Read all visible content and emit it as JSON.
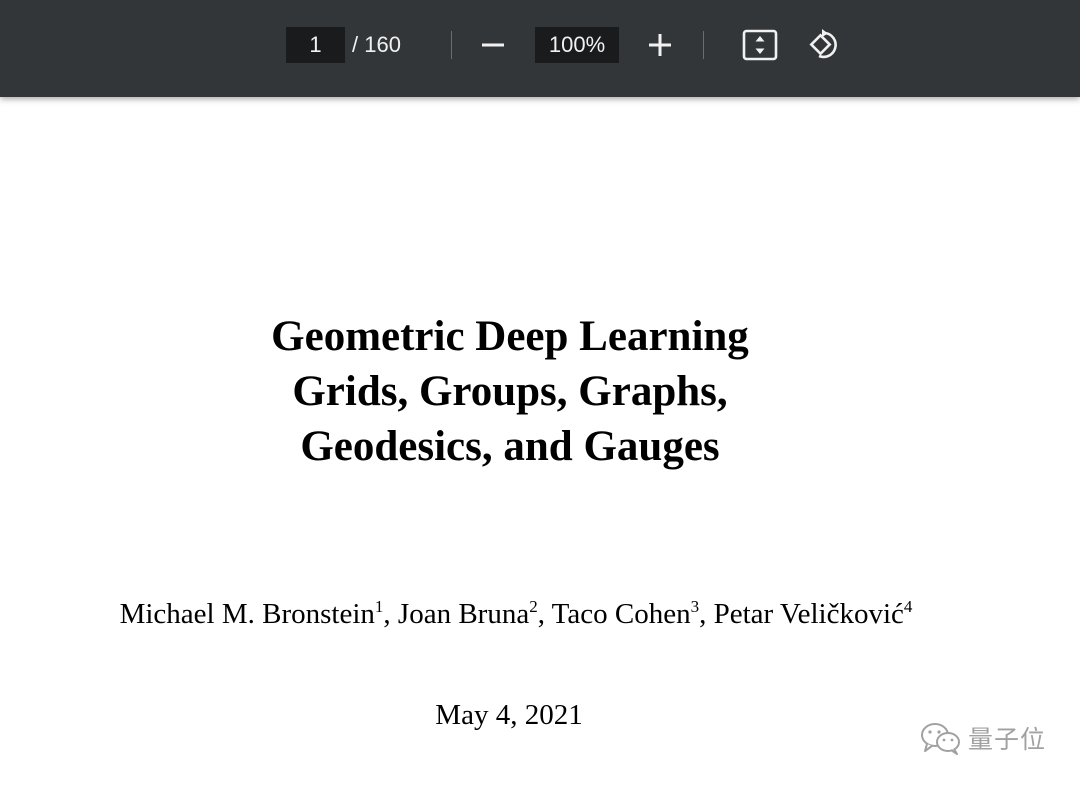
{
  "toolbar": {
    "current_page": "1",
    "page_total": "/ 160",
    "zoom_level": "100%",
    "icons": {
      "zoom_out": "minus-icon",
      "zoom_in": "plus-icon",
      "fit": "fit-to-page-icon",
      "rotate": "rotate-icon"
    }
  },
  "document": {
    "title_lines": [
      "Geometric Deep Learning",
      "Grids, Groups, Graphs,",
      "Geodesics, and Gauges"
    ],
    "authors": [
      {
        "name": "Michael M. Bronstein",
        "affiliation": "1"
      },
      {
        "name": "Joan Bruna",
        "affiliation": "2"
      },
      {
        "name": "Taco Cohen",
        "affiliation": "3"
      },
      {
        "name": "Petar Veličković",
        "affiliation": "4"
      }
    ],
    "author_separator": ", ",
    "date": "May 4, 2021"
  },
  "watermark": {
    "text": "量子位",
    "icon": "wechat-icon"
  },
  "colors": {
    "toolbar_bg": "#323639",
    "input_bg": "#191b1c",
    "toolbar_text": "#f1f1f1",
    "page_bg": "#ffffff"
  }
}
